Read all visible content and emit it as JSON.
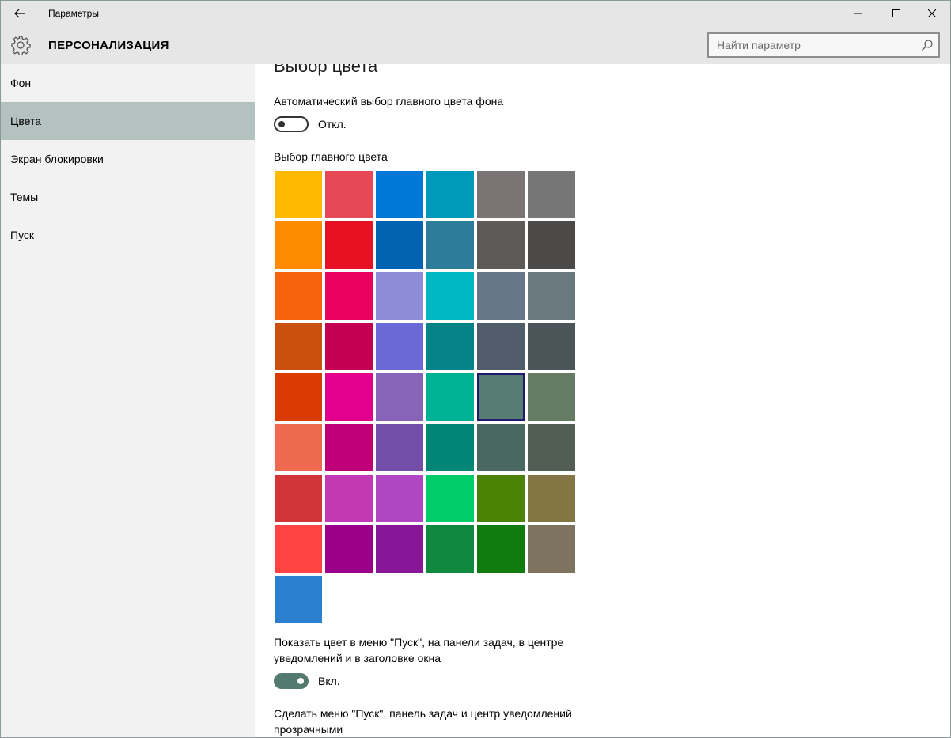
{
  "window": {
    "title": "Параметры"
  },
  "header": {
    "title": "ПЕРСОНАЛИЗАЦИЯ",
    "search_placeholder": "Найти параметр"
  },
  "sidebar": {
    "items": [
      {
        "label": "Фон"
      },
      {
        "label": "Цвета",
        "selected": true
      },
      {
        "label": "Экран блокировки"
      },
      {
        "label": "Темы"
      },
      {
        "label": "Пуск"
      }
    ]
  },
  "main": {
    "heading": "Выбор цвета",
    "auto_color_label": "Автоматический выбор главного цвета фона",
    "auto_color_state": "Откл.",
    "accent_label": "Выбор главного цвета",
    "show_color_label_line1": "Показать цвет в меню \"Пуск\", на панели задач, в центре",
    "show_color_label_line2": "уведомлений и в заголовке окна",
    "show_color_state": "Вкл.",
    "transparent_label_line1": "Сделать меню \"Пуск\", панель задач и центр уведомлений",
    "transparent_label_line2": "прозрачными"
  },
  "colors": {
    "selected_index": 28,
    "swatches": [
      "#ffb900",
      "#e74856",
      "#0078d7",
      "#0099bc",
      "#7a7574",
      "#767676",
      "#ff8c00",
      "#e81123",
      "#0063b1",
      "#2d7d9a",
      "#5d5a58",
      "#4c4a48",
      "#f7630c",
      "#ea005e",
      "#8e8cd8",
      "#00b7c3",
      "#68768a",
      "#69797e",
      "#ca5010",
      "#c30052",
      "#6b69d6",
      "#038387",
      "#515c6b",
      "#4a5459",
      "#da3b01",
      "#e3008c",
      "#8764b8",
      "#00b294",
      "#567c73",
      "#647c64",
      "#ef6950",
      "#bf0077",
      "#744da9",
      "#018574",
      "#486860",
      "#525e54",
      "#d13438",
      "#c239b3",
      "#b146c2",
      "#00cc6a",
      "#498205",
      "#847545",
      "#ff4343",
      "#9a0089",
      "#881798",
      "#10893e",
      "#107c10",
      "#7e735f",
      "#2b7fcf"
    ]
  }
}
